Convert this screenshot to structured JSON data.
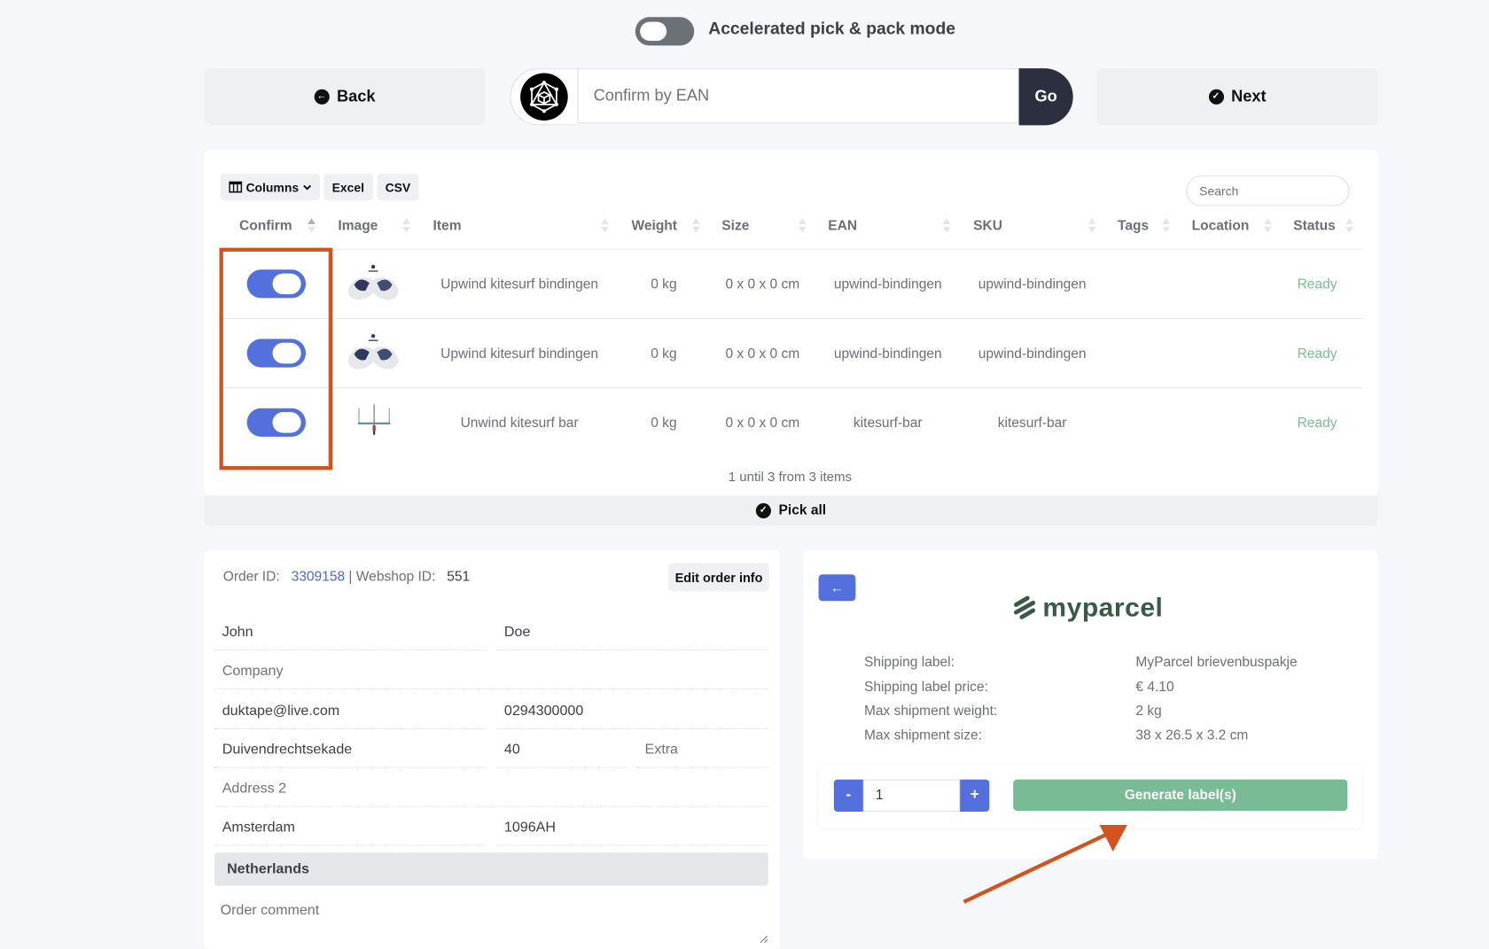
{
  "mode": {
    "label": "Accelerated pick & pack mode",
    "enabled": false
  },
  "nav": {
    "back_label": "Back",
    "next_label": "Next",
    "go_label": "Go",
    "ean_placeholder": "Confirm by EAN"
  },
  "table": {
    "toolbar": {
      "columns_label": "Columns",
      "excel_label": "Excel",
      "csv_label": "CSV"
    },
    "search_placeholder": "Search",
    "headers": [
      "Confirm",
      "Image",
      "Item",
      "Weight",
      "Size",
      "EAN",
      "SKU",
      "Tags",
      "Location",
      "Status"
    ],
    "rows": [
      {
        "confirmed": true,
        "image": "bindings-image",
        "item": "Upwind kitesurf bindingen",
        "weight": "0 kg",
        "size": "0 x 0 x 0 cm",
        "ean": "upwind-bindingen",
        "sku": "upwind-bindingen",
        "tags": "",
        "location": "",
        "status": "Ready"
      },
      {
        "confirmed": true,
        "image": "bindings-image",
        "item": "Upwind kitesurf bindingen",
        "weight": "0 kg",
        "size": "0 x 0 x 0 cm",
        "ean": "upwind-bindingen",
        "sku": "upwind-bindingen",
        "tags": "",
        "location": "",
        "status": "Ready"
      },
      {
        "confirmed": true,
        "image": "kite-bar-image",
        "item": "Unwind kitesurf bar",
        "weight": "0 kg",
        "size": "0 x 0 x 0 cm",
        "ean": "kitesurf-bar",
        "sku": "kitesurf-bar",
        "tags": "",
        "location": "",
        "status": "Ready"
      }
    ],
    "pager": "1 until 3 from 3 items",
    "pick_all_label": "Pick all"
  },
  "order": {
    "order_id_label": "Order ID:",
    "order_id": "3309158",
    "separator": "|",
    "webshop_id_label": "Webshop ID:",
    "webshop_id": "551",
    "edit_label": "Edit order info",
    "first_name": "John",
    "last_name": "Doe",
    "company_placeholder": "Company",
    "email": "duktape@live.com",
    "phone": "0294300000",
    "street": "Duivendrechtsekade",
    "house_number": "40",
    "extra_placeholder": "Extra",
    "address2_placeholder": "Address 2",
    "city": "Amsterdam",
    "postcode": "1096AH",
    "country": "Netherlands",
    "comment_placeholder": "Order comment"
  },
  "shipping": {
    "brand": "myparcel",
    "info": [
      {
        "label": "Shipping label:",
        "value": "MyParcel brievenbuspakje"
      },
      {
        "label": "Shipping label price:",
        "value": "€ 4.10"
      },
      {
        "label": "Max shipment weight:",
        "value": "2 kg"
      },
      {
        "label": "Max shipment size:",
        "value": "38 x 26.5 x 3.2 cm"
      }
    ],
    "quantity": "1",
    "minus_label": "-",
    "plus_label": "+",
    "generate_label": "Generate label(s)"
  },
  "colors": {
    "accent": "#5470dc",
    "ready": "#78c08f",
    "generate": "#79bb95",
    "annotation": "#d3531f",
    "go": "#2b2f40"
  }
}
